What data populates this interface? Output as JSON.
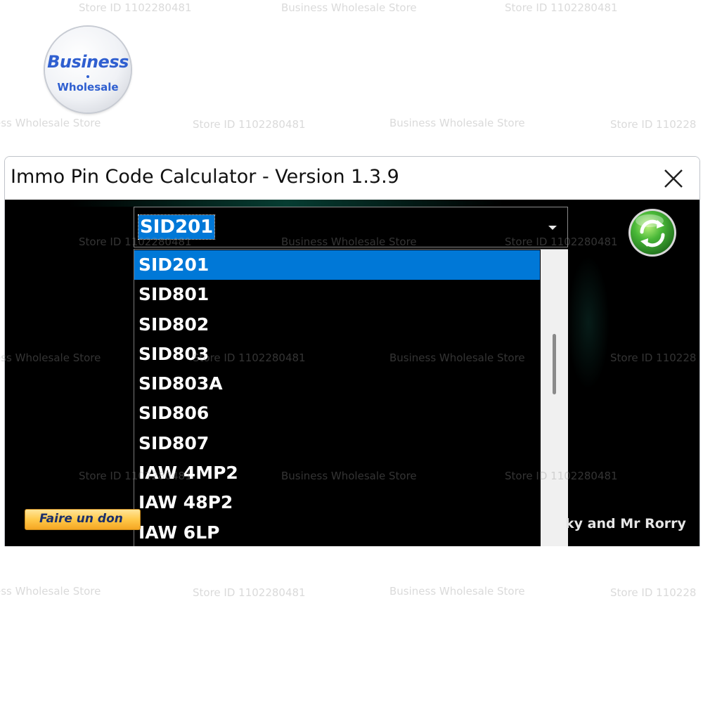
{
  "logo": {
    "line1": "Business",
    "line2": "Wholesale"
  },
  "watermarks": [
    "Store ID 1102280481",
    "Business Wholesale Store",
    "Store ID 1102280481",
    "ess Wholesale Store",
    "Store ID 1102280481",
    "Business Wholesale Store",
    "Store ID 110228",
    "Store ID 1102280481",
    "Business Wholesale Store",
    "Store ID 1102280481",
    "ess Wholesale Store",
    "Store ID 1102280481",
    "Business Wholesale Store",
    "Store ID 110228",
    "Store ID 1102280481",
    "Business Wholesale Store",
    "Store ID 1102280481",
    "ess Wholesale Store",
    "Store ID 1102280481",
    "Business Wholesale Store",
    "Store ID 110228"
  ],
  "window": {
    "title": "Immo Pin Code Calculator  -  Version 1.3.9"
  },
  "combo": {
    "value": "SID201",
    "options": [
      "SID201",
      "SID801",
      "SID802",
      "SID803",
      "SID803A",
      "SID806",
      "SID807",
      "IAW 4MP2",
      "IAW 48P2",
      "IAW 6LP"
    ],
    "selected_index": 0
  },
  "donate": {
    "label": "Faire un don"
  },
  "credits": {
    "text": "ky and Mr Rorry"
  },
  "colors": {
    "selection": "#0078d7",
    "client_background": "#000000",
    "refresh_green": "#3bb34a"
  }
}
